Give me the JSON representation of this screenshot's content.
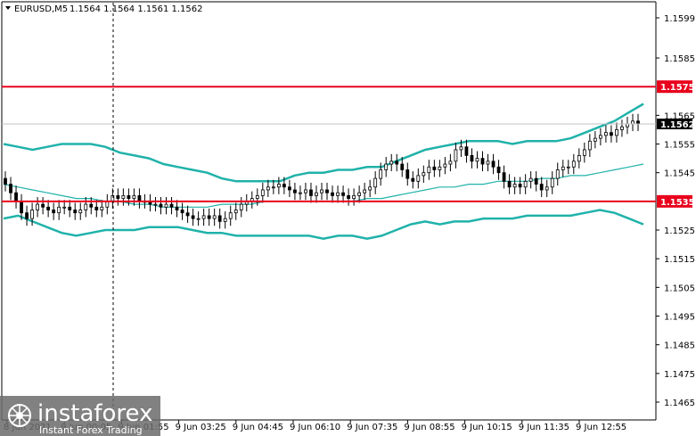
{
  "header": {
    "symbol": "EURUSD,M5",
    "ohlc": "1.1564 1.1564 1.1561 1.1562"
  },
  "price_axis": {
    "ticks": [
      "1.1599",
      "1.1585",
      "1.1565",
      "1.1555",
      "1.1545",
      "1.1525",
      "1.1515",
      "1.1505",
      "1.1495",
      "1.1485",
      "1.1475",
      "1.1465"
    ],
    "tick_values": [
      1.1599,
      1.1585,
      1.1565,
      1.1555,
      1.1545,
      1.1525,
      1.1515,
      1.1505,
      1.1495,
      1.1485,
      1.1475,
      1.1465
    ]
  },
  "time_axis": {
    "labels": [
      "8 Jun 2021",
      "9 Jun 00:05",
      "9 Jun 01:55",
      "9 Jun 03:25",
      "9 Jun 04:45",
      "9 Jun 06:10",
      "9 Jun 07:35",
      "9 Jun 08:55",
      "9 Jun 10:15",
      "9 Jun 11:35",
      "9 Jun 12:55"
    ]
  },
  "levels": [
    {
      "price": 1.1575,
      "label": "1.1575",
      "color": "#e8001c"
    },
    {
      "price": 1.1535,
      "label": "1.1535",
      "color": "#e8001c"
    }
  ],
  "current_price": {
    "price": 1.1562,
    "label": "1.1562"
  },
  "colors": {
    "bands": "#20b2aa",
    "levels": "#e8001c",
    "candles": "#000000",
    "cursor": "#000000"
  },
  "watermark": {
    "brand": "instaforex",
    "tagline": "Instant Forex Trading"
  },
  "chart_data": {
    "type": "candlestick",
    "y_range": [
      1.146,
      1.1605
    ],
    "closes": [
      1.1541,
      1.1538,
      1.1535,
      1.1531,
      1.1529,
      1.1532,
      1.1534,
      1.1533,
      1.1532,
      1.1531,
      1.1533,
      1.1533,
      1.1532,
      1.1531,
      1.1532,
      1.1534,
      1.1533,
      1.1532,
      1.1533,
      1.1535,
      1.1537,
      1.1536,
      1.1537,
      1.1536,
      1.1537,
      1.1535,
      1.1535,
      1.1534,
      1.1534,
      1.1533,
      1.1534,
      1.1533,
      1.1532,
      1.1531,
      1.153,
      1.1529,
      1.1529,
      1.153,
      1.1529,
      1.153,
      1.1528,
      1.1529,
      1.1531,
      1.1532,
      1.1534,
      1.1535,
      1.1536,
      1.1537,
      1.1539,
      1.154,
      1.154,
      1.1541,
      1.154,
      1.1539,
      1.1538,
      1.1538,
      1.1539,
      1.1537,
      1.1538,
      1.1539,
      1.1538,
      1.1537,
      1.1538,
      1.1537,
      1.1536,
      1.1537,
      1.1538,
      1.1539,
      1.154,
      1.1543,
      1.1546,
      1.1548,
      1.1549,
      1.1548,
      1.1546,
      1.1543,
      1.1542,
      1.1544,
      1.1545,
      1.1547,
      1.1546,
      1.1547,
      1.1548,
      1.1549,
      1.1553,
      1.1554,
      1.1551,
      1.1549,
      1.155,
      1.1548,
      1.1549,
      1.1547,
      1.1545,
      1.1542,
      1.154,
      1.1541,
      1.154,
      1.1542,
      1.1543,
      1.1541,
      1.1539,
      1.154,
      1.1543,
      1.1546,
      1.1547,
      1.1547,
      1.1549,
      1.1551,
      1.1553,
      1.1556,
      1.1557,
      1.1558,
      1.1559,
      1.1558,
      1.156,
      1.1561,
      1.1562,
      1.1563,
      1.1562
    ],
    "upper_band": [
      1.1555,
      1.1554,
      1.1553,
      1.1554,
      1.1555,
      1.1555,
      1.1555,
      1.1554,
      1.1552,
      1.1551,
      1.155,
      1.1548,
      1.1547,
      1.1546,
      1.1545,
      1.1543,
      1.1542,
      1.1542,
      1.1542,
      1.1542,
      1.1544,
      1.1545,
      1.1545,
      1.1546,
      1.1546,
      1.1547,
      1.1547,
      1.1549,
      1.1551,
      1.1553,
      1.1554,
      1.1555,
      1.1556,
      1.1556,
      1.1556,
      1.1555,
      1.1556,
      1.1556,
      1.1556,
      1.1557,
      1.1559,
      1.1561,
      1.1563,
      1.1566,
      1.1569
    ],
    "middle_band": [
      1.1541,
      1.154,
      1.1539,
      1.1538,
      1.1537,
      1.1536,
      1.1536,
      1.1535,
      1.1535,
      1.1534,
      1.1534,
      1.1533,
      1.1533,
      1.1533,
      1.1533,
      1.1534,
      1.1534,
      1.1534,
      1.1535,
      1.1535,
      1.1535,
      1.1535,
      1.1535,
      1.1535,
      1.1535,
      1.1536,
      1.1536,
      1.1537,
      1.1538,
      1.1539,
      1.154,
      1.154,
      1.1541,
      1.1541,
      1.1542,
      1.1542,
      1.1542,
      1.1543,
      1.1543,
      1.1544,
      1.1544,
      1.1545,
      1.1546,
      1.1547,
      1.1548
    ],
    "lower_band": [
      1.1529,
      1.153,
      1.1528,
      1.1526,
      1.1524,
      1.1523,
      1.1524,
      1.1525,
      1.1525,
      1.1525,
      1.1526,
      1.1526,
      1.1526,
      1.1525,
      1.1524,
      1.1524,
      1.1523,
      1.1523,
      1.1523,
      1.1523,
      1.1523,
      1.1523,
      1.1522,
      1.1523,
      1.1523,
      1.1522,
      1.1523,
      1.1525,
      1.1527,
      1.1528,
      1.1527,
      1.1528,
      1.1528,
      1.1529,
      1.1529,
      1.1529,
      1.153,
      1.153,
      1.153,
      1.153,
      1.1531,
      1.1532,
      1.1531,
      1.1529,
      1.1527
    ]
  }
}
